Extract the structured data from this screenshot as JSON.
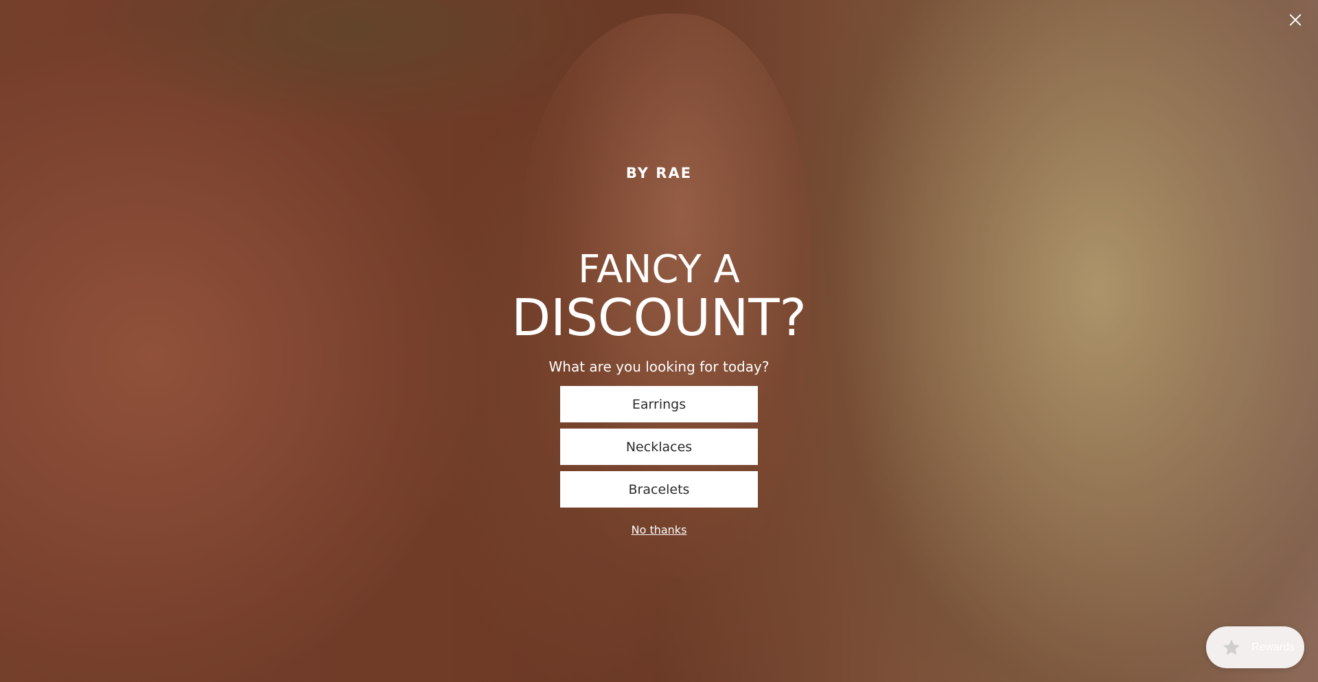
{
  "popup": {
    "brand": "BY RAE",
    "headline_line1": "FANCY A",
    "headline_line2": "DISCOUNT?",
    "subtitle": "What are you looking for today?",
    "options": [
      "Earrings",
      "Necklaces",
      "Bracelets"
    ],
    "dismiss_label": "No thanks"
  },
  "rewards": {
    "label": "Rewards",
    "icon": "star-icon"
  },
  "close": {
    "icon": "close-icon"
  },
  "colors": {
    "text_on_image": "#ffffff",
    "button_bg": "#ffffff",
    "button_text": "#2a2a2a",
    "rewards_bg": "#f2efee"
  }
}
